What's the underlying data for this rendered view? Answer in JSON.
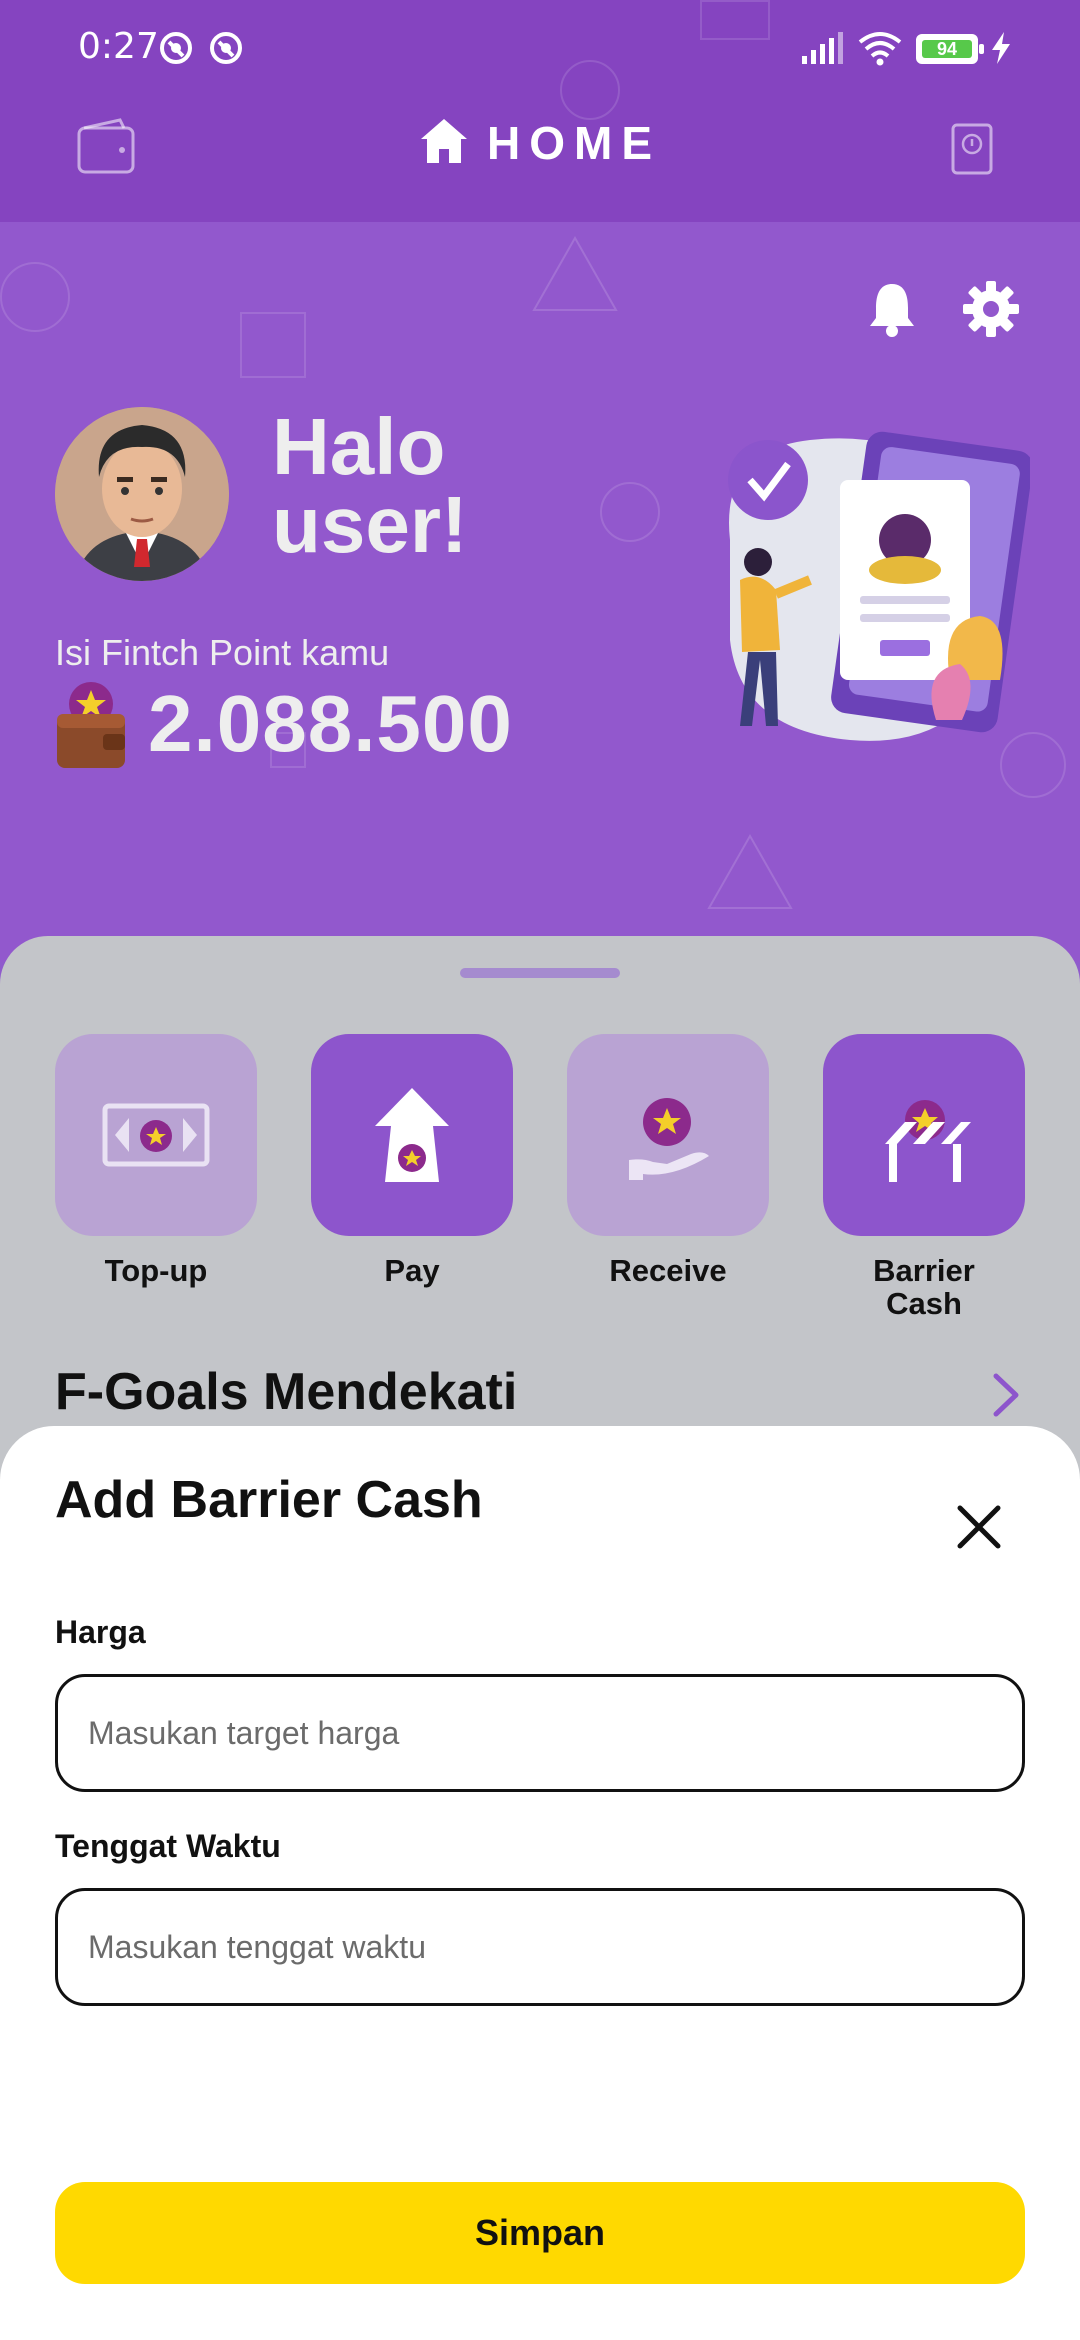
{
  "status_bar": {
    "time": "0:27",
    "battery": "94",
    "icons": [
      "notification-icon",
      "notification-icon",
      "signal-icon",
      "wifi-icon",
      "battery-icon",
      "charging-icon"
    ]
  },
  "app_bar": {
    "title": "HOME",
    "left_icon": "wallet-icon",
    "right_icon": "book-icon"
  },
  "header": {
    "greeting_line1": "Halo",
    "greeting_line2": "user!",
    "point_label": "Isi Fintch Point kamu",
    "point_value": "2.088.500"
  },
  "quick_actions": [
    {
      "label": "Top-up",
      "icon": "top-up-icon"
    },
    {
      "label": "Pay",
      "icon": "pay-icon"
    },
    {
      "label": "Receive",
      "icon": "receive-icon"
    },
    {
      "label_line1": "Barrier",
      "label_line2": "Cash",
      "icon": "barrier-cash-icon"
    }
  ],
  "section": {
    "title": "F-Goals Mendekati"
  },
  "sheet": {
    "title": "Add Barrier Cash",
    "fields": [
      {
        "label": "Harga",
        "placeholder": "Masukan target harga",
        "value": ""
      },
      {
        "label": "Tenggat Waktu",
        "placeholder": "Masukan tenggat waktu",
        "value": ""
      }
    ],
    "submit_label": "Simpan"
  },
  "colors": {
    "app_bar": "#8544c0",
    "header": "#9258cd",
    "accent_purple": "#8d55cc",
    "primary_button": "#ffd900",
    "star": "#f4cf2a"
  }
}
